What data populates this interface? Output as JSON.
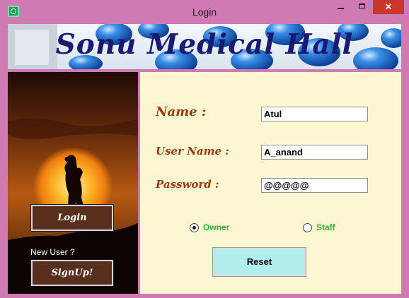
{
  "window": {
    "title": "Login",
    "controls": {
      "minimize": "",
      "maximize": "",
      "close": "✕"
    }
  },
  "banner": {
    "title": "Sonu Medical Hall"
  },
  "sidebar": {
    "login_label": "Login",
    "new_user_label": "New User ?",
    "signup_label": "SignUp!"
  },
  "form": {
    "name_label": "Name :",
    "name_value": "Atul",
    "username_label": "User Name :",
    "username_value": "A_anand",
    "password_label": "Password :",
    "password_value": "@@@@@",
    "role_options": [
      {
        "label": "Owner",
        "selected": true
      },
      {
        "label": "Staff",
        "selected": false
      }
    ],
    "reset_label": "Reset"
  },
  "colors": {
    "window_frame": "#d07ab3",
    "form_background": "#fdf6d2",
    "field_label": "#9b3b0c",
    "radio_label": "#2fae2f",
    "reset_button": "#b2eeee",
    "side_button": "#5a2e1c",
    "banner_text": "#1b1a73"
  },
  "icons": [
    "app-icon",
    "minimize-icon",
    "maximize-icon",
    "close-icon"
  ]
}
